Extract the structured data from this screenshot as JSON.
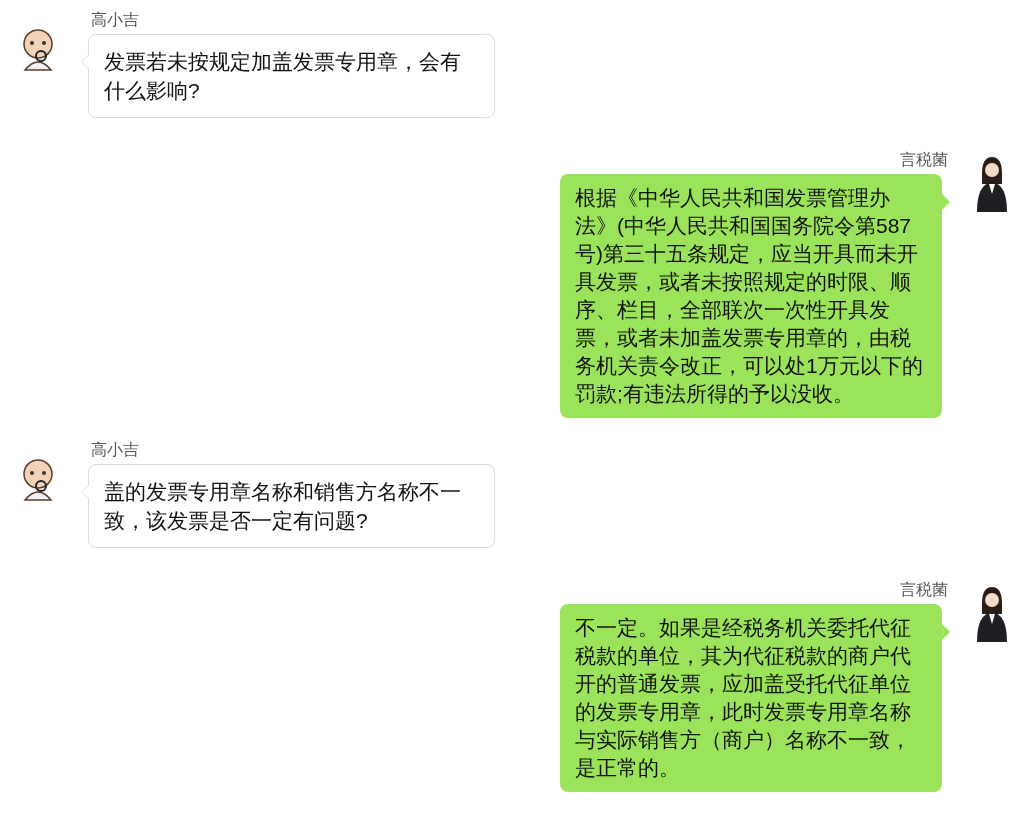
{
  "messages": [
    {
      "kind": "left",
      "sender": "高小吉",
      "text": "发票若未按规定加盖发票专用章，会有什么影响?"
    },
    {
      "kind": "right",
      "sender": "言税菌",
      "text": "根据《中华人民共和国发票管理办法》(中华人民共和国国务院令第587号)第三十五条规定，应当开具而未开具发票，或者未按照规定的时限、顺序、栏目，全部联次一次性开具发票，或者未加盖发票专用章的，由税务机关责令改正，可以处1万元以下的罚款;有违法所得的予以没收。"
    },
    {
      "kind": "left",
      "sender": "高小吉",
      "text": "盖的发票专用章名称和销售方名称不一致，该发票是否一定有问题?"
    },
    {
      "kind": "right",
      "sender": "言税菌",
      "text": "不一定。如果是经税务机关委托代征税款的单位，其为代征税款的商户代开的普通发票，应加盖受托代征单位的发票专用章，此时发票专用章名称与实际销售方（商户）名称不一致，是正常的。"
    }
  ]
}
